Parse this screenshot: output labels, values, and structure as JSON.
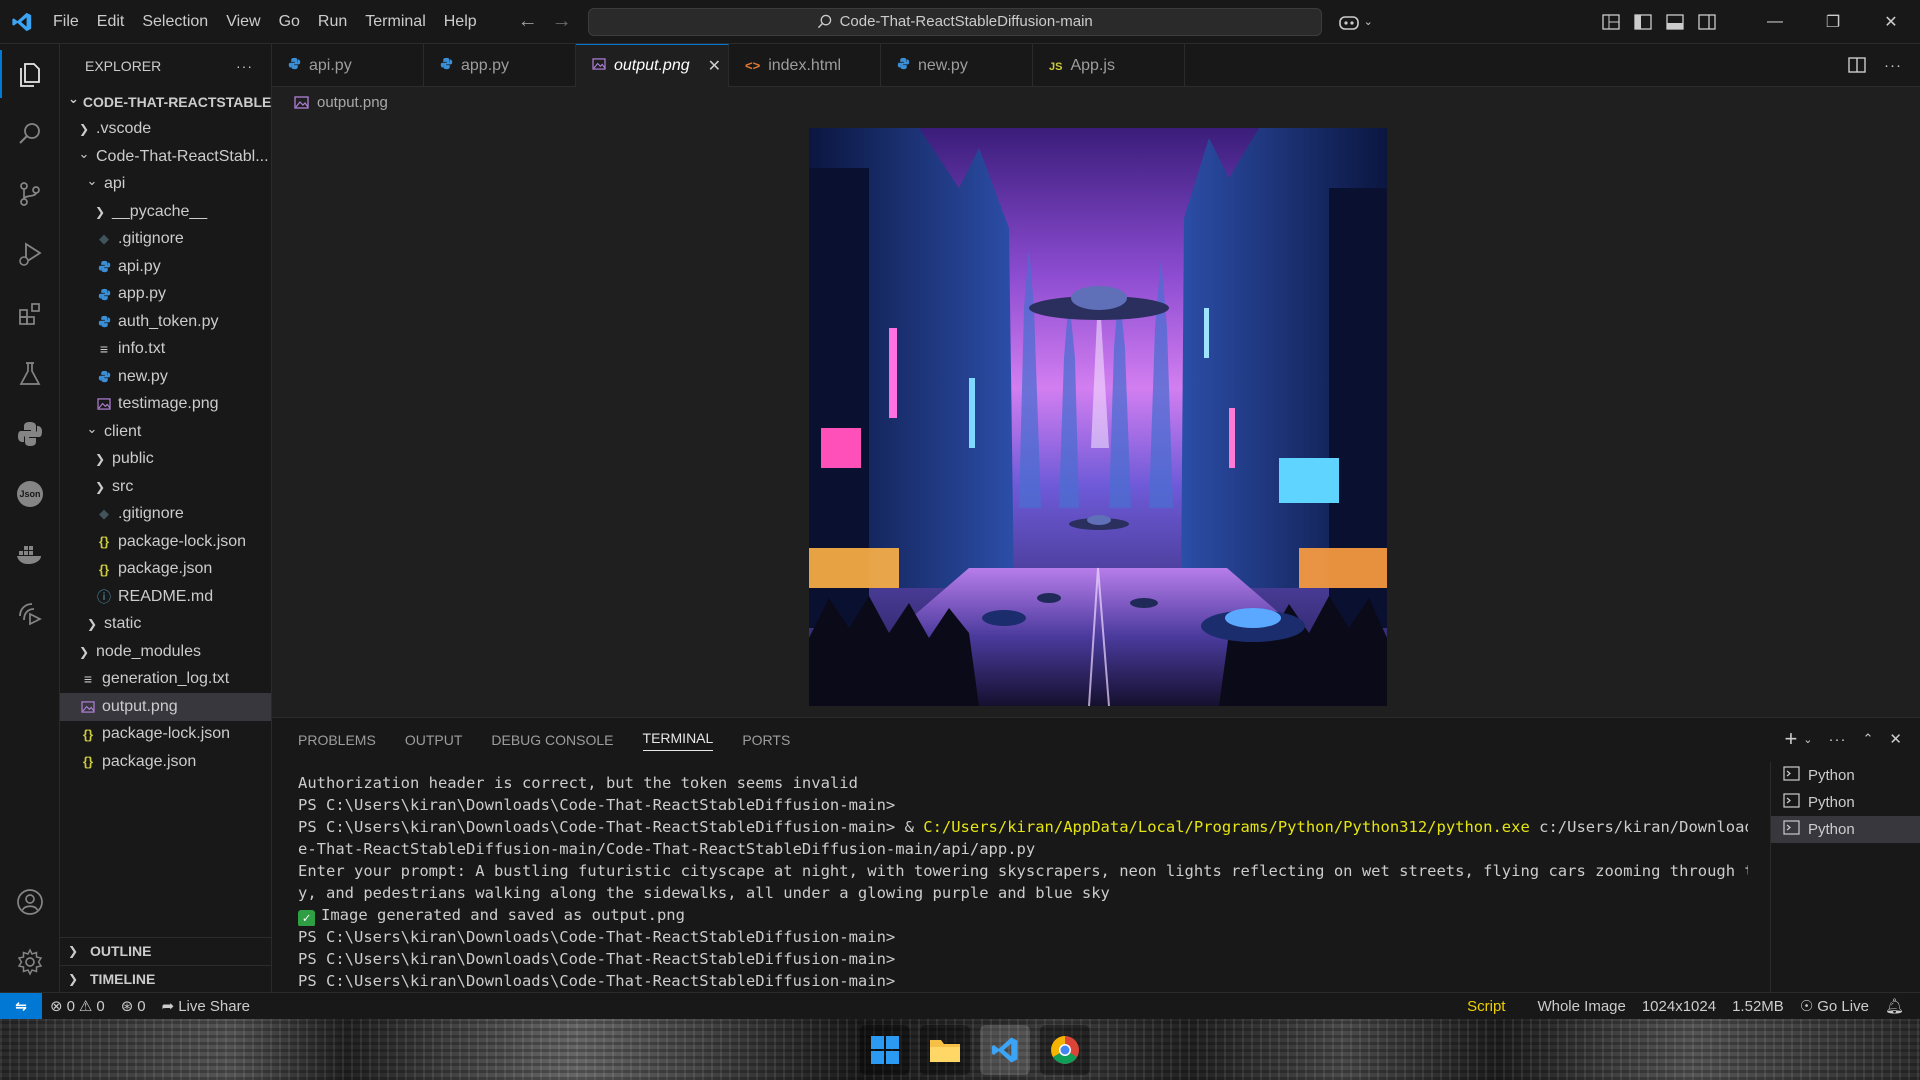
{
  "titlebar": {
    "menu": [
      "File",
      "Edit",
      "Selection",
      "View",
      "Go",
      "Run",
      "Terminal",
      "Help"
    ],
    "search_text": "Code-That-ReactStableDiffusion-main"
  },
  "sidebar": {
    "header": "EXPLORER",
    "tree": [
      {
        "label": "CODE-THAT-REACTSTABLE...",
        "depth": 0,
        "kind": "root",
        "icon": "chevron-down-icon"
      },
      {
        "label": ".vscode",
        "depth": 1,
        "kind": "folder-closed"
      },
      {
        "label": "Code-That-ReactStabl...",
        "depth": 1,
        "kind": "folder-open"
      },
      {
        "label": "api",
        "depth": 2,
        "kind": "folder-open"
      },
      {
        "label": "__pycache__",
        "depth": 3,
        "kind": "folder-closed"
      },
      {
        "label": ".gitignore",
        "depth": 3,
        "kind": "git"
      },
      {
        "label": "api.py",
        "depth": 3,
        "kind": "python"
      },
      {
        "label": "app.py",
        "depth": 3,
        "kind": "python"
      },
      {
        "label": "auth_token.py",
        "depth": 3,
        "kind": "python"
      },
      {
        "label": "info.txt",
        "depth": 3,
        "kind": "text"
      },
      {
        "label": "new.py",
        "depth": 3,
        "kind": "python"
      },
      {
        "label": "testimage.png",
        "depth": 3,
        "kind": "image"
      },
      {
        "label": "client",
        "depth": 2,
        "kind": "folder-open"
      },
      {
        "label": "public",
        "depth": 3,
        "kind": "folder-closed"
      },
      {
        "label": "src",
        "depth": 3,
        "kind": "folder-closed"
      },
      {
        "label": ".gitignore",
        "depth": 3,
        "kind": "git"
      },
      {
        "label": "package-lock.json",
        "depth": 3,
        "kind": "json"
      },
      {
        "label": "package.json",
        "depth": 3,
        "kind": "json"
      },
      {
        "label": "README.md",
        "depth": 3,
        "kind": "info"
      },
      {
        "label": "static",
        "depth": 2,
        "kind": "folder-closed"
      },
      {
        "label": "node_modules",
        "depth": 1,
        "kind": "folder-closed"
      },
      {
        "label": "generation_log.txt",
        "depth": 1,
        "kind": "text"
      },
      {
        "label": "output.png",
        "depth": 1,
        "kind": "image",
        "selected": true
      },
      {
        "label": "package-lock.json",
        "depth": 1,
        "kind": "json"
      },
      {
        "label": "package.json",
        "depth": 1,
        "kind": "json"
      }
    ],
    "outline": "OUTLINE",
    "timeline": "TIMELINE"
  },
  "tabs": [
    {
      "label": "api.py",
      "icon": "python-icon"
    },
    {
      "label": "app.py",
      "icon": "python-icon"
    },
    {
      "label": "output.png",
      "icon": "image-file-icon",
      "active": true
    },
    {
      "label": "index.html",
      "icon": "html-icon"
    },
    {
      "label": "new.py",
      "icon": "python-icon"
    },
    {
      "label": "App.js",
      "icon": "js-icon"
    }
  ],
  "breadcrumb": "output.png",
  "panel": {
    "tabs": [
      "PROBLEMS",
      "OUTPUT",
      "DEBUG CONSOLE",
      "TERMINAL",
      "PORTS"
    ],
    "active_tab": "TERMINAL",
    "terminal_lines": [
      "Authorization header is correct, but the token seems invalid",
      "PS C:\\Users\\kiran\\Downloads\\Code-That-ReactStableDiffusion-main>",
      "",
      "e-That-ReactStableDiffusion-main/Code-That-ReactStableDiffusion-main/api/app.py",
      "Enter your prompt: A bustling futuristic cityscape at night, with towering skyscrapers, neon lights reflecting on wet streets, flying cars zooming through the sk",
      "y, and pedestrians walking along the sidewalks, all under a glowing purple and blue sky",
      "",
      "PS C:\\Users\\kiran\\Downloads\\Code-That-ReactStableDiffusion-main>",
      "PS C:\\Users\\kiran\\Downloads\\Code-That-ReactStableDiffusion-main>",
      "PS C:\\Users\\kiran\\Downloads\\Code-That-ReactStableDiffusion-main>"
    ],
    "command_line": {
      "prefix": "PS C:\\Users\\kiran\\Downloads\\Code-That-ReactStableDiffusion-main> & ",
      "exe": "C:/Users/kiran/AppData/Local/Programs/Python/Python312/python.exe",
      "arg": " c:/Users/kiran/Downloads/Cod"
    },
    "success_line": "Image generated and saved as output.png",
    "terminals": [
      "Python",
      "Python",
      "Python"
    ]
  },
  "statusbar": {
    "errors": "0",
    "warnings": "0",
    "ports": "0",
    "live_share": "Live Share",
    "script": "Script",
    "zoom": "Whole Image",
    "dimensions": "1024x1024",
    "size": "1.52MB",
    "go_live": "Go Live"
  },
  "colors": {
    "accent": "#0078d4",
    "terminal_exe": "#e5e510",
    "status_script": "#f0d000"
  }
}
